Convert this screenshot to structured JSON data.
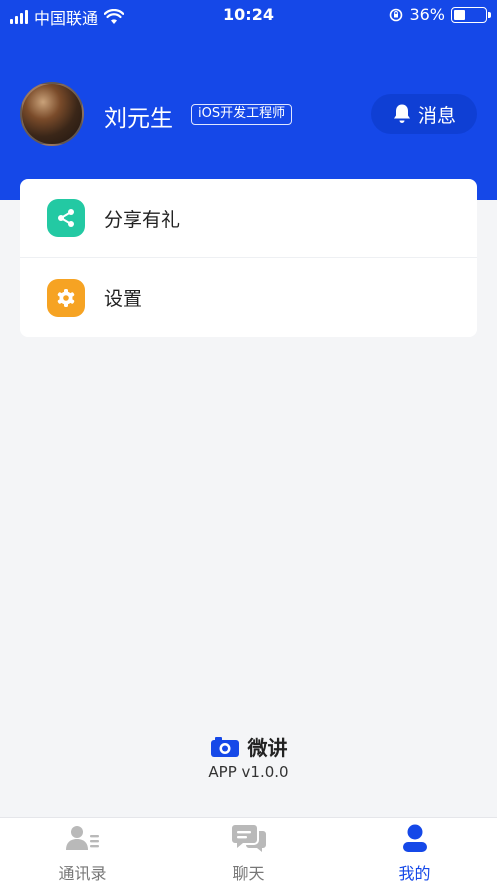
{
  "status_bar": {
    "carrier": "中国联通",
    "time": "10:24",
    "battery_percent": "36%",
    "battery_level": 0.36
  },
  "profile": {
    "name": "刘元生",
    "role": "iOS开发工程师",
    "message_button": "消息"
  },
  "menu": {
    "items": [
      {
        "label": "分享有礼",
        "icon": "share-icon",
        "color": "#23c9a3"
      },
      {
        "label": "设置",
        "icon": "gear-icon",
        "color": "#f6a323"
      }
    ]
  },
  "footer": {
    "brand": "微讲",
    "version": "APP v1.0.0"
  },
  "tabbar": {
    "tabs": [
      {
        "label": "通讯录",
        "icon": "contacts-icon"
      },
      {
        "label": "聊天",
        "icon": "chat-icon"
      },
      {
        "label": "我的",
        "icon": "user-icon",
        "active": true
      }
    ]
  },
  "colors": {
    "primary": "#1548e8",
    "background": "#f4f5f7",
    "inactive_tab": "#777777"
  }
}
